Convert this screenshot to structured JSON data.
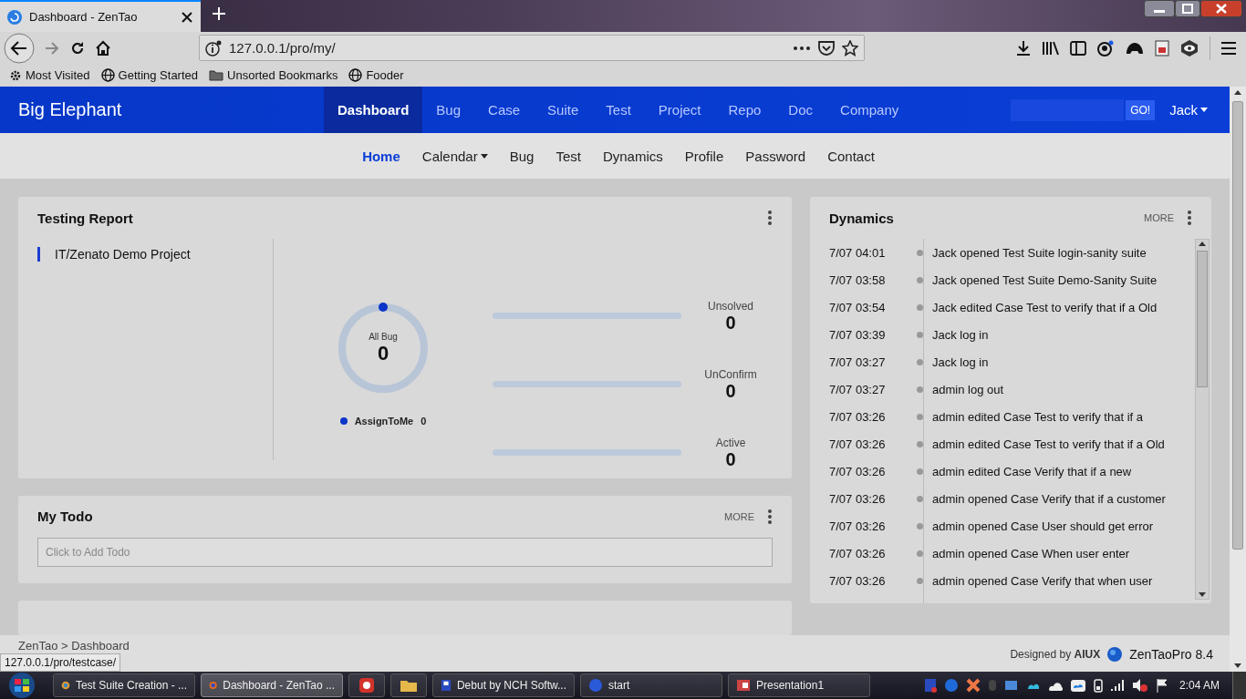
{
  "browser": {
    "tab": {
      "title": "Dashboard - ZenTao",
      "selected": true
    },
    "url": "127.0.0.1/pro/my/",
    "bookmarks": [
      {
        "kind": "gear",
        "label": "Most Visited"
      },
      {
        "kind": "globe",
        "label": "Getting Started"
      },
      {
        "kind": "folder",
        "label": "Unsorted Bookmarks"
      },
      {
        "kind": "globe",
        "label": "Fooder"
      }
    ]
  },
  "app": {
    "brand": "Big Elephant",
    "nav": [
      {
        "label": "Dashboard",
        "selected": true
      },
      {
        "label": "Bug",
        "selected": false
      },
      {
        "label": "Case",
        "selected": false
      },
      {
        "label": "Suite",
        "selected": false
      },
      {
        "label": "Test",
        "selected": false
      },
      {
        "label": "Project",
        "selected": false
      },
      {
        "label": "Repo",
        "selected": false
      },
      {
        "label": "Doc",
        "selected": false
      },
      {
        "label": "Company",
        "selected": false
      }
    ],
    "search_button": "GO!",
    "user": "Jack"
  },
  "subnav": [
    {
      "label": "Home",
      "selected": true,
      "dropdown": false
    },
    {
      "label": "Calendar",
      "selected": false,
      "dropdown": true
    },
    {
      "label": "Bug",
      "selected": false,
      "dropdown": false
    },
    {
      "label": "Test",
      "selected": false,
      "dropdown": false
    },
    {
      "label": "Dynamics",
      "selected": false,
      "dropdown": false
    },
    {
      "label": "Profile",
      "selected": false,
      "dropdown": false
    },
    {
      "label": "Password",
      "selected": false,
      "dropdown": false
    },
    {
      "label": "Contact",
      "selected": false,
      "dropdown": false
    }
  ],
  "testing_report": {
    "title": "Testing Report",
    "projects": [
      {
        "name": "IT/Zenato Demo Project",
        "selected": true
      }
    ],
    "donut": {
      "label": "All Bug",
      "value": "0"
    },
    "legend": {
      "label": "AssignToMe",
      "value": "0"
    },
    "bars": [
      {
        "label": "Unsolved",
        "value": "0",
        "level": 0
      },
      {
        "label": "UnConfirm",
        "value": "0",
        "level": 0
      },
      {
        "label": "Active",
        "value": "0",
        "level": 0
      }
    ]
  },
  "todo": {
    "title": "My Todo",
    "more": "MORE",
    "placeholder": "Click to Add Todo"
  },
  "dynamics": {
    "title": "Dynamics",
    "more": "MORE",
    "items": [
      {
        "time": "7/07 04:01",
        "text": "Jack opened Test Suite login-sanity suite"
      },
      {
        "time": "7/07 03:58",
        "text": "Jack opened Test Suite Demo-Sanity Suite"
      },
      {
        "time": "7/07 03:54",
        "text": "Jack edited Case Test to verify that if a Old"
      },
      {
        "time": "7/07 03:39",
        "text": "Jack log in"
      },
      {
        "time": "7/07 03:27",
        "text": "Jack log in"
      },
      {
        "time": "7/07 03:27",
        "text": "admin log out"
      },
      {
        "time": "7/07 03:26",
        "text": "admin edited Case Test to verify that if a"
      },
      {
        "time": "7/07 03:26",
        "text": "admin edited Case Test to verify that if a Old"
      },
      {
        "time": "7/07 03:26",
        "text": "admin edited Case Verify that if a new"
      },
      {
        "time": "7/07 03:26",
        "text": "admin opened Case Verify that if a customer"
      },
      {
        "time": "7/07 03:26",
        "text": "admin opened Case User should get error"
      },
      {
        "time": "7/07 03:26",
        "text": "admin opened Case When user enter"
      },
      {
        "time": "7/07 03:26",
        "text": "admin opened Case Verify that when user"
      }
    ]
  },
  "footer": {
    "breadcrumb": "ZenTao > Dashboard",
    "designed_by": "Designed by **AIUX**",
    "version": "ZenTaoPro 8.4"
  },
  "status_url": "127.0.0.1/pro/testcase/",
  "taskbar": {
    "items": [
      {
        "kind": "window",
        "label": "Test Suite Creation - ...",
        "selected": false
      },
      {
        "kind": "window",
        "label": "Dashboard - ZenTao ...",
        "selected": true
      },
      {
        "kind": "pinned",
        "selected": false
      },
      {
        "kind": "pinned",
        "selected": false
      },
      {
        "kind": "window",
        "label": "Debut by NCH Softw...",
        "selected": false
      },
      {
        "kind": "window",
        "label": "start",
        "selected": false
      },
      {
        "kind": "window",
        "label": "Presentation1",
        "selected": false
      }
    ],
    "clock": "2:04 AM"
  }
}
